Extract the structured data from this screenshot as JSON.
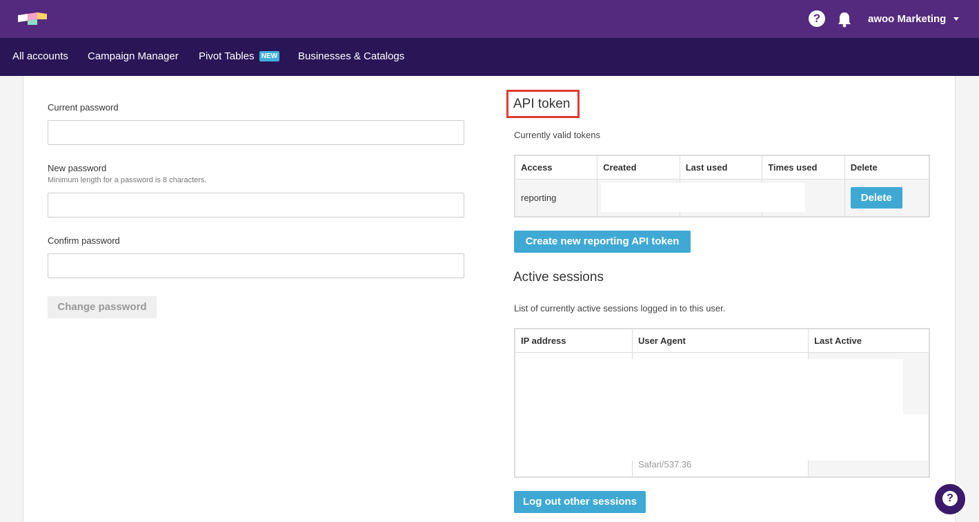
{
  "header": {
    "account_name": "awoo Marketing",
    "logo_icon": "brand-logo-icon",
    "help_icon": "help-icon",
    "bell_icon": "bell-icon"
  },
  "nav": {
    "items": [
      {
        "label": "All accounts"
      },
      {
        "label": "Campaign Manager"
      },
      {
        "label": "Pivot Tables",
        "badge": "NEW"
      },
      {
        "label": "Businesses & Catalogs"
      }
    ]
  },
  "password_form": {
    "current_label": "Current password",
    "new_label": "New password",
    "new_hint": "Minimum length for a password is 8 characters.",
    "confirm_label": "Confirm password",
    "submit_label": "Change password"
  },
  "api_token": {
    "title": "API token",
    "subtitle": "Currently valid tokens",
    "columns": [
      "Access",
      "Created",
      "Last used",
      "Times used",
      "Delete"
    ],
    "rows": [
      {
        "access": "reporting",
        "created": "",
        "last_used": "",
        "times_used": "",
        "delete_label": "Delete"
      }
    ],
    "create_label": "Create new reporting API token"
  },
  "sessions": {
    "title": "Active sessions",
    "subtitle": "List of currently active sessions logged in to this user.",
    "columns": [
      "IP address",
      "User Agent",
      "Last Active"
    ],
    "rows": [
      {
        "ip": "",
        "user_agent": "Safari/537.36",
        "last_active": ""
      }
    ],
    "logout_label": "Log out other sessions"
  },
  "colors": {
    "topbar": "#542a7e",
    "navbar": "#2a1557",
    "primary_button": "#3fa9d4",
    "highlight_border": "#e03a2f"
  }
}
